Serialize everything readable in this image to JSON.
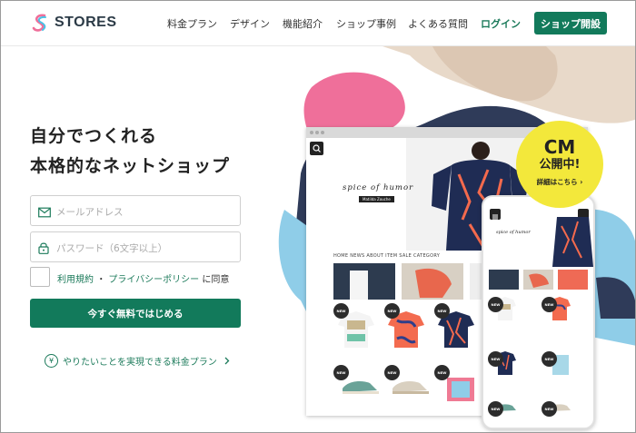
{
  "brand": {
    "name": "STORES"
  },
  "nav": {
    "items": [
      "料金プラン",
      "デザイン",
      "機能紹介",
      "ショップ事例",
      "よくある質問"
    ],
    "login": "ログイン",
    "open_shop": "ショップ開設"
  },
  "hero": {
    "headline_line1": "自分でつくれる",
    "headline_line2": "本格的なネットショップ"
  },
  "form": {
    "email_placeholder": "メールアドレス",
    "password_placeholder": "パスワード（6文字以上）",
    "terms_link": "利用規約",
    "terms_sep": "・",
    "privacy_link": "プライバシーポリシー",
    "terms_suffix": "に同意",
    "submit": "今すぐ無料ではじめる",
    "plan_link": "やりたいことを実現できる料金プラン",
    "yen_symbol": "¥"
  },
  "mock": {
    "brand": "spice of humor",
    "brand_tag": "Matilda Zouche",
    "nav": "HOME   NEWS   ABOUT   ITEM   SALE   CATEGORY",
    "phone_brand": "spice of humor",
    "badge": "NEW"
  },
  "cm_badge": {
    "line1": "CM",
    "line2": "公開中!",
    "line3": "詳細はこちら ›"
  },
  "colors": {
    "primary": "#127a5b",
    "link": "#1b7a5a",
    "cm_yellow": "#f3e83b",
    "blob_pink": "#ef6f9a",
    "blob_blue": "#8fcde8",
    "blob_navy": "#2f3b59",
    "blob_beige": "#e8d9c9"
  }
}
